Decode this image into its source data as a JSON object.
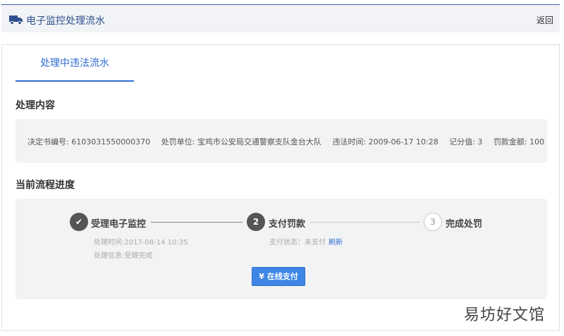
{
  "header": {
    "title": "电子监控处理流水",
    "back_label": "返回"
  },
  "tab": {
    "label": "处理中违法流水"
  },
  "content_section": {
    "title": "处理内容",
    "fields": [
      "决定书编号: 6103031550000370",
      "处罚单位: 宝鸡市公安局交通警察支队金台大队",
      "违法时间: 2009-06-17 10:28",
      "记分值: 3",
      "罚款金额: 100"
    ]
  },
  "progress_section": {
    "title": "当前流程进度",
    "steps": [
      {
        "number": "✔",
        "label": "受理电子监控",
        "state": "done"
      },
      {
        "number": "2",
        "label": "支付罚款",
        "state": "active"
      },
      {
        "number": "3",
        "label": "完成处罚",
        "state": "todo"
      }
    ],
    "step1_time": "处理时间:2017-08-14 10:35",
    "step1_info": "处理信息:受理完成",
    "step2_status": "支付状态：未支付",
    "refresh_label": "刷新",
    "pay_button": "¥ 在线支付"
  },
  "watermark": "易坊好文馆",
  "colors": {
    "accent": "#2e6cd1",
    "header_border": "#3d5fa8",
    "button": "#3e86e6"
  }
}
